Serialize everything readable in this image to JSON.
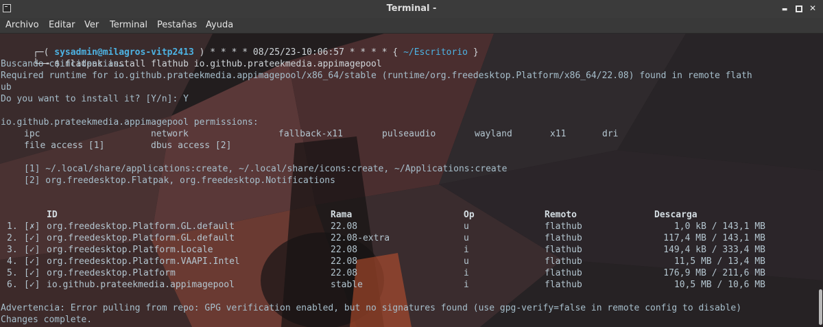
{
  "window": {
    "title": "Terminal -",
    "controls": {
      "minimize": "▬",
      "close": "✕"
    }
  },
  "menu": [
    "Archivo",
    "Editar",
    "Ver",
    "Terminal",
    "Pestañas",
    "Ayuda"
  ],
  "prompt": {
    "corner_top": "┌─(",
    "corner_bottom": "└─╼",
    "user_host": "sysadmin@milagros-vitp2413",
    "close_paren": ")",
    "stars_left": "* * * *",
    "timestamp": "08/25/23-10:06:57",
    "stars_right": "* * * *",
    "cwd_open": "{",
    "cwd": "~/Escritorio",
    "cwd_close": "}",
    "symbol": "$",
    "command": "flatpak install flathub io.github.prateekmedia.appimagepool"
  },
  "output": {
    "searching": "Buscando coincidencias…",
    "required_1": "Required runtime for io.github.prateekmedia.appimagepool/x86_64/stable (runtime/org.freedesktop.Platform/x86_64/22.08) found in remote flath",
    "required_2": "ub",
    "question": "Do you want to install it? [Y/n]: Y",
    "permissions_title": "io.github.prateekmedia.appimagepool permissions:",
    "permissions_row1": [
      "ipc",
      "network",
      "fallback-x11",
      "pulseaudio",
      "wayland",
      "x11",
      "dri"
    ],
    "permissions_row2": [
      "file access [1]",
      "dbus access [2]"
    ],
    "note_1": "[1] ~/.local/share/applications:create, ~/.local/share/icons:create, ~/Applications:create",
    "note_2": "[2] org.freedesktop.Flatpak, org.freedesktop.Notifications",
    "warning": "Advertencia: Error pulling from repo: GPG verification enabled, but no signatures found (use gpg-verify=false in remote config to disable)",
    "complete": "Changes complete."
  },
  "table": {
    "headers": {
      "id": "ID",
      "rama": "Rama",
      "op": "Op",
      "remoto": "Remoto",
      "descarga": "Descarga"
    },
    "rows": [
      {
        "num": "1.",
        "mark": "[✗]",
        "id": "org.freedesktop.Platform.GL.default",
        "rama": "22.08",
        "op": "u",
        "remoto": "flathub",
        "descarga": "1,0 kB / 143,1 MB"
      },
      {
        "num": "2.",
        "mark": "[✓]",
        "id": "org.freedesktop.Platform.GL.default",
        "rama": "22.08-extra",
        "op": "u",
        "remoto": "flathub",
        "descarga": "117,4 MB / 143,1 MB"
      },
      {
        "num": "3.",
        "mark": "[✓]",
        "id": "org.freedesktop.Platform.Locale",
        "rama": "22.08",
        "op": "i",
        "remoto": "flathub",
        "descarga": "149,4 kB / 333,4 MB"
      },
      {
        "num": "4.",
        "mark": "[✓]",
        "id": "org.freedesktop.Platform.VAAPI.Intel",
        "rama": "22.08",
        "op": "u",
        "remoto": "flathub",
        "descarga": "11,5 MB / 13,4 MB"
      },
      {
        "num": "5.",
        "mark": "[✓]",
        "id": "org.freedesktop.Platform",
        "rama": "22.08",
        "op": "i",
        "remoto": "flathub",
        "descarga": "176,9 MB / 211,6 MB"
      },
      {
        "num": "6.",
        "mark": "[✓]",
        "id": "io.github.prateekmedia.appimagepool",
        "rama": "stable",
        "op": "i",
        "remoto": "flathub",
        "descarga": "10,5 MB / 10,6 MB"
      }
    ]
  },
  "colors": {
    "prompt": "#4db3e4",
    "text": "#a7bfcc",
    "titlebar": "#3b3b3b",
    "menubar": "#393939"
  }
}
